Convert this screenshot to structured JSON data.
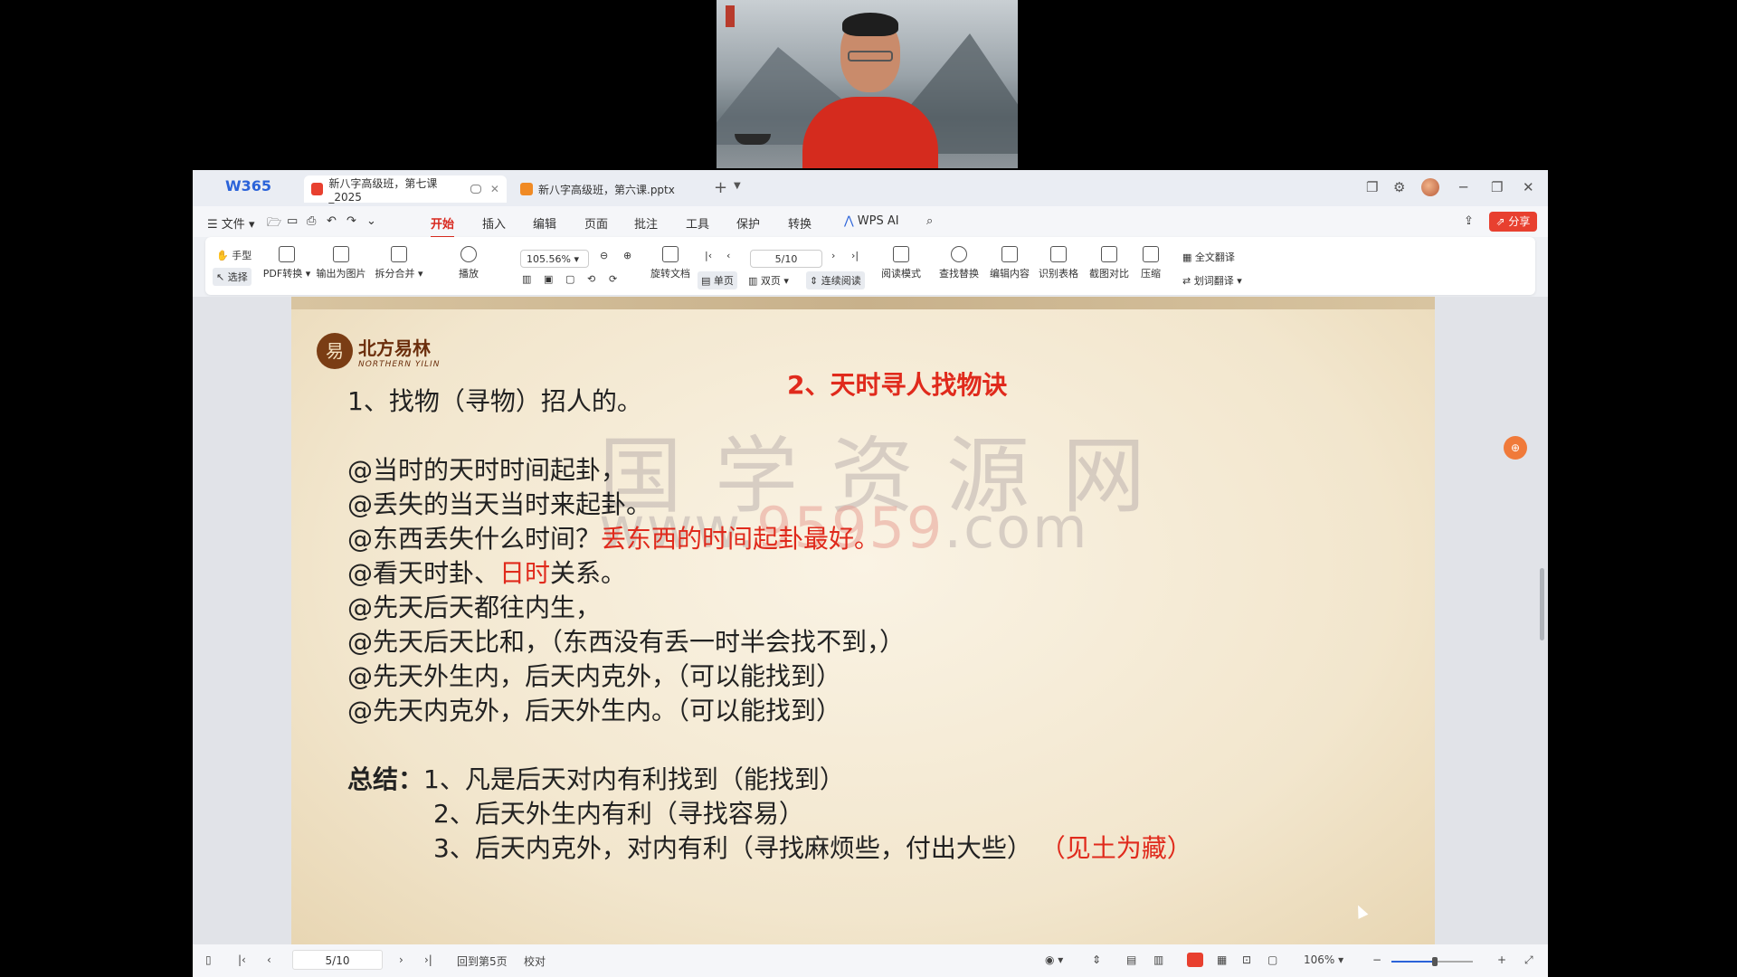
{
  "app": {
    "brand": "W365"
  },
  "tabs": [
    {
      "label": "新八字高级班，第七课_2025",
      "icon": "pdf-icon",
      "color": "#e8402f",
      "active": true
    },
    {
      "label": "新八字高级班，第六课.pptx",
      "icon": "ppt-icon",
      "color": "#f08a24",
      "active": false
    }
  ],
  "menus": [
    "文件",
    "开始",
    "插入",
    "编辑",
    "页面",
    "批注",
    "工具",
    "保护",
    "转换",
    "WPS AI"
  ],
  "share_label": "分享",
  "ribbon": {
    "hand": "手型",
    "select": "选择",
    "pdf_convert": "PDF转换",
    "export_image": "输出为图片",
    "split_merge": "拆分合并",
    "play": "播放",
    "zoom": "105.56%",
    "page": "5/10",
    "rotate": "旋转文档",
    "single": "单页",
    "double": "双页",
    "continuous": "连续阅读",
    "read_mode": "阅读模式",
    "find_replace": "查找替换",
    "edit_content": "编辑内容",
    "recognize_table": "识别表格",
    "compare": "截图对比",
    "compress": "压缩",
    "full_translate": "全文翻译",
    "word_translate": "划词翻译"
  },
  "slide": {
    "logo_cn": "北方易林",
    "logo_en": "NORTHERN YILIN",
    "title": "2、天时寻人找物诀",
    "watermark_cn": "国学资源网",
    "watermark_url_pre": "www.",
    "watermark_url_num": "95959",
    "watermark_url_post": ".com",
    "line1": "1、找物（寻物）招人的。",
    "line2": "@当时的天时时间起卦，",
    "line3": "@丢失的当天当时来起卦。",
    "line4a": "@东西丢失什么时间？",
    "line4b": "丢东西的时间起卦最好。",
    "line5a": "@看天时卦、",
    "line5b": "日时",
    "line5c": "关系。",
    "line6": "@先天后天都往内生，",
    "line7": "@先天后天比和，（东西没有丢一时半会找不到，）",
    "line8": "@先天外生内，后天内克外，（可以能找到）",
    "line9": "@先天内克外，后天外生内。（可以能找到）",
    "summary_label": "总结：",
    "summary1": "1、凡是后天对内有利找到（能找到）",
    "summary2": "2、后天外生内有利（寻找容易）",
    "summary3a": "3、后天内克外，对内有利（寻找麻烦些，付出大些）",
    "summary3b": "（见土为藏）"
  },
  "status": {
    "page": "5/10",
    "back_to_page": "回到第5页",
    "proofread": "校对",
    "zoom": "106%"
  },
  "colors": {
    "accent_red": "#e02a1c",
    "brand_blue": "#2b63d9"
  }
}
